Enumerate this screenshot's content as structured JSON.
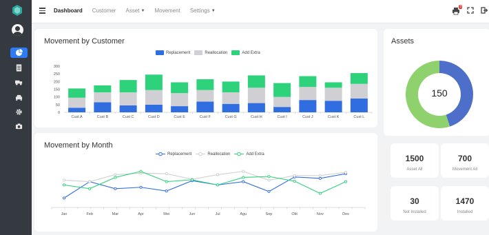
{
  "nav": {
    "menu": [
      {
        "label": "Dashboard",
        "active": true,
        "dropdown": false
      },
      {
        "label": "Customer",
        "active": false,
        "dropdown": false
      },
      {
        "label": "Asset",
        "active": false,
        "dropdown": true
      },
      {
        "label": "Movement",
        "active": false,
        "dropdown": false
      },
      {
        "label": "Settings",
        "active": false,
        "dropdown": true
      }
    ],
    "notification_badge": "3",
    "sidebar_icons": [
      "chart-pie-icon",
      "document-icon",
      "truck-icon",
      "car-icon",
      "gear-icon",
      "camera-icon"
    ]
  },
  "colors": {
    "replacement": "#2f6de1",
    "reallocation": "#cfcfd4",
    "add_extra": "#2ed27a",
    "donut_blue": "#4d6fc9",
    "donut_green": "#8ed16d",
    "sidebar_active": "#2d7cf6"
  },
  "movement_by_customer": {
    "title": "Movement by Customer",
    "chart_data": {
      "type": "bar",
      "stacked": true,
      "categories": [
        "Cust A",
        "Cust B",
        "Cust C",
        "Cust D",
        "Cust E",
        "Cust F",
        "Cust G",
        "Cust H",
        "Cust I",
        "Cust J",
        "Cust K",
        "Cust L"
      ],
      "series": [
        {
          "name": "Replacement",
          "values": [
            30,
            65,
            45,
            50,
            40,
            70,
            55,
            60,
            35,
            80,
            75,
            90
          ]
        },
        {
          "name": "Reallocation",
          "values": [
            65,
            65,
            85,
            95,
            85,
            75,
            75,
            100,
            65,
            85,
            85,
            95
          ]
        },
        {
          "name": "Add Extra",
          "values": [
            60,
            45,
            80,
            100,
            70,
            70,
            70,
            80,
            90,
            70,
            35,
            70
          ]
        }
      ],
      "ylim": [
        0,
        300
      ],
      "yticks": [
        0,
        50,
        100,
        150,
        200,
        250,
        300
      ],
      "legend": "top-center",
      "grid": false
    }
  },
  "movement_by_month": {
    "title": "Movement by Month",
    "chart_data": {
      "type": "line",
      "categories": [
        "Jan",
        "Feb",
        "Mar",
        "Apr",
        "Mei",
        "Jun",
        "Jul",
        "Agu",
        "Sep",
        "Okt",
        "Nov",
        "Des"
      ],
      "series": [
        {
          "name": "Replacement",
          "values": [
            20,
            55,
            40,
            43,
            35,
            57,
            48,
            55,
            34,
            65,
            62,
            72
          ]
        },
        {
          "name": "Reallocation",
          "values": [
            58,
            55,
            70,
            73,
            72,
            60,
            70,
            77,
            58,
            68,
            68,
            75
          ]
        },
        {
          "name": "Add Extra",
          "values": [
            48,
            40,
            64,
            77,
            55,
            59,
            48,
            64,
            66,
            56,
            30,
            55
          ]
        }
      ],
      "legend": "top-center",
      "grid": false
    }
  },
  "assets": {
    "title": "Assets",
    "total": "150",
    "chart_data": {
      "type": "pie",
      "donut": true,
      "values": [
        45,
        55
      ]
    }
  },
  "stats": [
    {
      "value": "1500",
      "label": "Asset All"
    },
    {
      "value": "700",
      "label": "Movement All"
    },
    {
      "value": "30",
      "label": "Not Installed"
    },
    {
      "value": "1470",
      "label": "Installed"
    }
  ]
}
